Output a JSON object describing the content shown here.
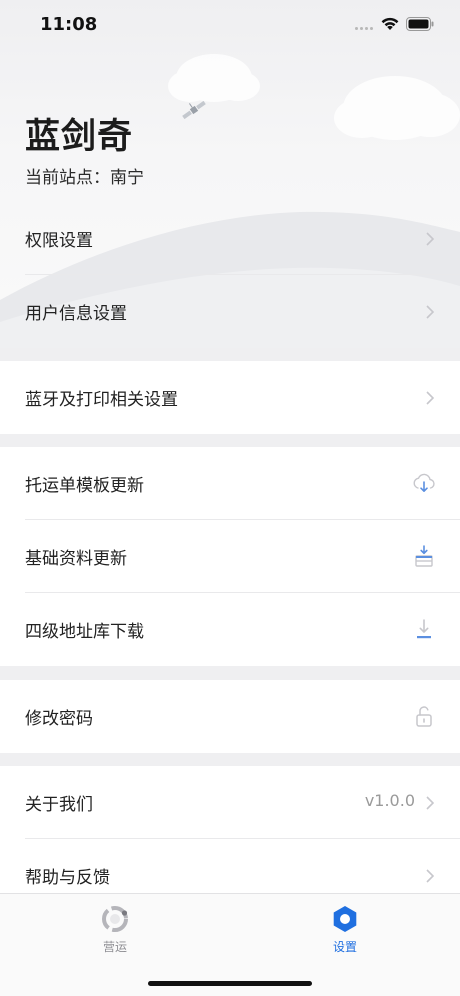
{
  "status_bar": {
    "time": "11:08"
  },
  "profile": {
    "name": "蓝剑奇",
    "station": "当前站点：南宁"
  },
  "menu": {
    "permissions": "权限设置",
    "user_info": "用户信息设置",
    "bluetooth_print": "蓝牙及打印相关设置",
    "waybill_template_update": "托运单模板更新",
    "basic_data_update": "基础资料更新",
    "address_db_download": "四级地址库下载",
    "change_password": "修改密码",
    "about_us": "关于我们",
    "version": "v1.0.0",
    "help_feedback": "帮助与反馈"
  },
  "tabbar": {
    "operations": "营运",
    "settings": "设置"
  },
  "colors": {
    "accent": "#1f6fe0",
    "inactive_tab": "#8e8e93",
    "icon_gray": "#c7c7cc"
  },
  "icons": {
    "chevron": "chevron-right-icon",
    "cloud_download": "cloud-download-icon",
    "tray_download": "tray-download-icon",
    "download": "download-icon",
    "unlock": "unlock-icon",
    "tab_operations": "operations-ring-icon",
    "tab_settings": "settings-hexagon-icon"
  }
}
